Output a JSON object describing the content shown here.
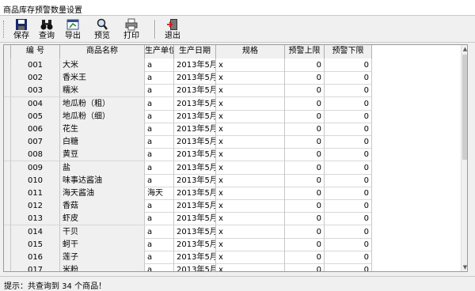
{
  "window": {
    "title": "商品库存预警数量设置"
  },
  "toolbar": {
    "save": "保存",
    "query": "查询",
    "export": "导出",
    "preview": "预览",
    "print": "打印",
    "exit": "退出"
  },
  "table": {
    "headers": [
      "编  号",
      "商品名称",
      "生产单位",
      "生产日期",
      "规格",
      "预警上限",
      "预警下限"
    ],
    "rows": [
      [
        "001",
        "大米",
        "a",
        "2013年5月2",
        "x",
        "0",
        "0"
      ],
      [
        "002",
        "香米王",
        "a",
        "2013年5月2",
        "x",
        "0",
        "0"
      ],
      [
        "003",
        "糯米",
        "a",
        "2013年5月2",
        "x",
        "0",
        "0"
      ],
      [
        "004",
        "地瓜粉（粗）",
        "a",
        "2013年5月2",
        "x",
        "0",
        "0"
      ],
      [
        "005",
        "地瓜粉（细）",
        "a",
        "2013年5月2",
        "x",
        "0",
        "0"
      ],
      [
        "006",
        "花生",
        "a",
        "2013年5月2",
        "x",
        "0",
        "0"
      ],
      [
        "007",
        "白糖",
        "a",
        "2013年5月2",
        "x",
        "0",
        "0"
      ],
      [
        "008",
        "黄豆",
        "a",
        "2013年5月2",
        "x",
        "0",
        "0"
      ],
      [
        "009",
        "盐",
        "a",
        "2013年5月2",
        "x",
        "0",
        "0"
      ],
      [
        "010",
        "味事达酱油",
        "a",
        "2013年5月2",
        "x",
        "0",
        "0"
      ],
      [
        "011",
        "海天酱油",
        "海天",
        "2013年5月2",
        "x",
        "0",
        "0"
      ],
      [
        "012",
        "香菇",
        "a",
        "2013年5月2",
        "x",
        "0",
        "0"
      ],
      [
        "013",
        "虾皮",
        "a",
        "2013年5月2",
        "x",
        "0",
        "0"
      ],
      [
        "014",
        "干贝",
        "a",
        "2013年5月2",
        "x",
        "0",
        "0"
      ],
      [
        "015",
        "蚵干",
        "a",
        "2013年5月2",
        "x",
        "0",
        "0"
      ],
      [
        "016",
        "莲子",
        "a",
        "2013年5月2",
        "x",
        "0",
        "0"
      ],
      [
        "017",
        "米粉",
        "a",
        "2013年5月2",
        "x",
        "0",
        "0"
      ]
    ]
  },
  "status": {
    "text": "提示：共查询到 34 个商品！"
  },
  "icons": {
    "save": "floppy-disk-icon",
    "query": "binoculars-icon",
    "export": "export-icon",
    "preview": "magnifier-icon",
    "print": "printer-icon",
    "exit": "exit-door-icon"
  }
}
